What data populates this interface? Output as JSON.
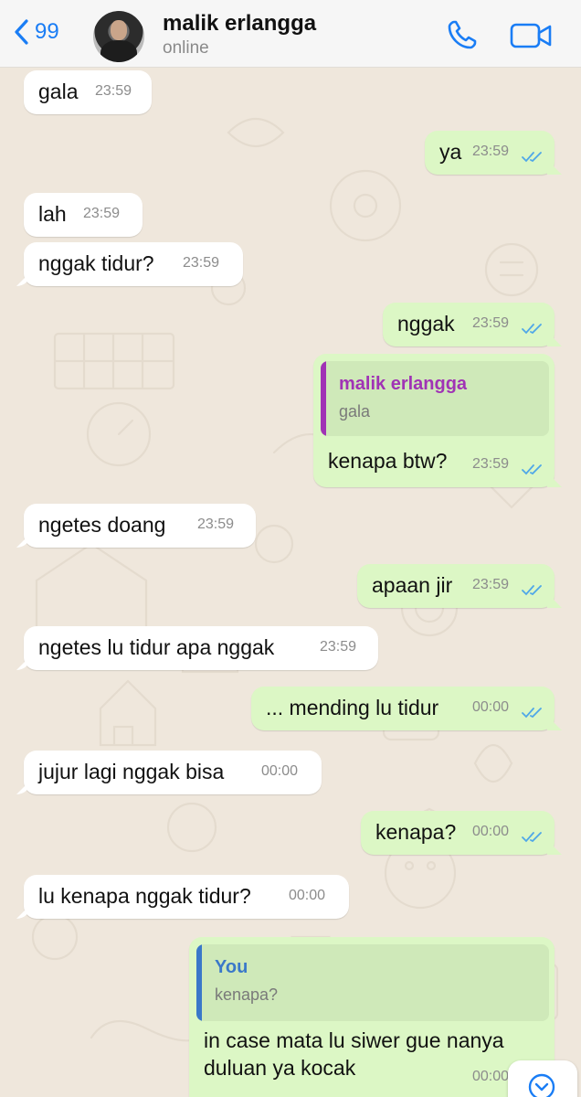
{
  "header": {
    "back_count": "99",
    "contact_name": "malik erlangga",
    "contact_status": "online"
  },
  "messages": [
    {
      "text": "gala",
      "time": "23:59"
    },
    {
      "text": "ya",
      "time": "23:59"
    },
    {
      "text": "lah",
      "time": "23:59"
    },
    {
      "text": "nggak tidur?",
      "time": "23:59"
    },
    {
      "text": "nggak",
      "time": "23:59"
    },
    {
      "text": "kenapa btw?",
      "time": "23:59",
      "quote_name": "malik erlangga",
      "quote_text": "gala"
    },
    {
      "text": "ngetes doang",
      "time": "23:59"
    },
    {
      "text": "apaan jir",
      "time": "23:59"
    },
    {
      "text": "ngetes lu tidur apa nggak",
      "time": "23:59"
    },
    {
      "text": "... mending lu tidur",
      "time": "00:00"
    },
    {
      "text": "jujur lagi nggak bisa",
      "time": "00:00"
    },
    {
      "text": "kenapa?",
      "time": "00:00"
    },
    {
      "text": "lu kenapa nggak tidur?",
      "time": "00:00"
    },
    {
      "text_line1": "in case mata lu siwer gue nanya",
      "text_line2": "duluan ya kocak",
      "time": "00:00",
      "quote_name": "You",
      "quote_text": "kenapa?"
    }
  ],
  "colors": {
    "accent": "#1a7df5",
    "incoming_bubble": "#ffffff",
    "outgoing_bubble": "#dcf7c5",
    "read_ticks": "#4fa7e8",
    "quote_contact": "#a033b5",
    "quote_you": "#3a78c9",
    "background": "#efe7dc"
  },
  "icons": [
    "chevron-left-icon",
    "phone-icon",
    "video-camera-icon",
    "double-check-icon",
    "scroll-down-icon"
  ]
}
